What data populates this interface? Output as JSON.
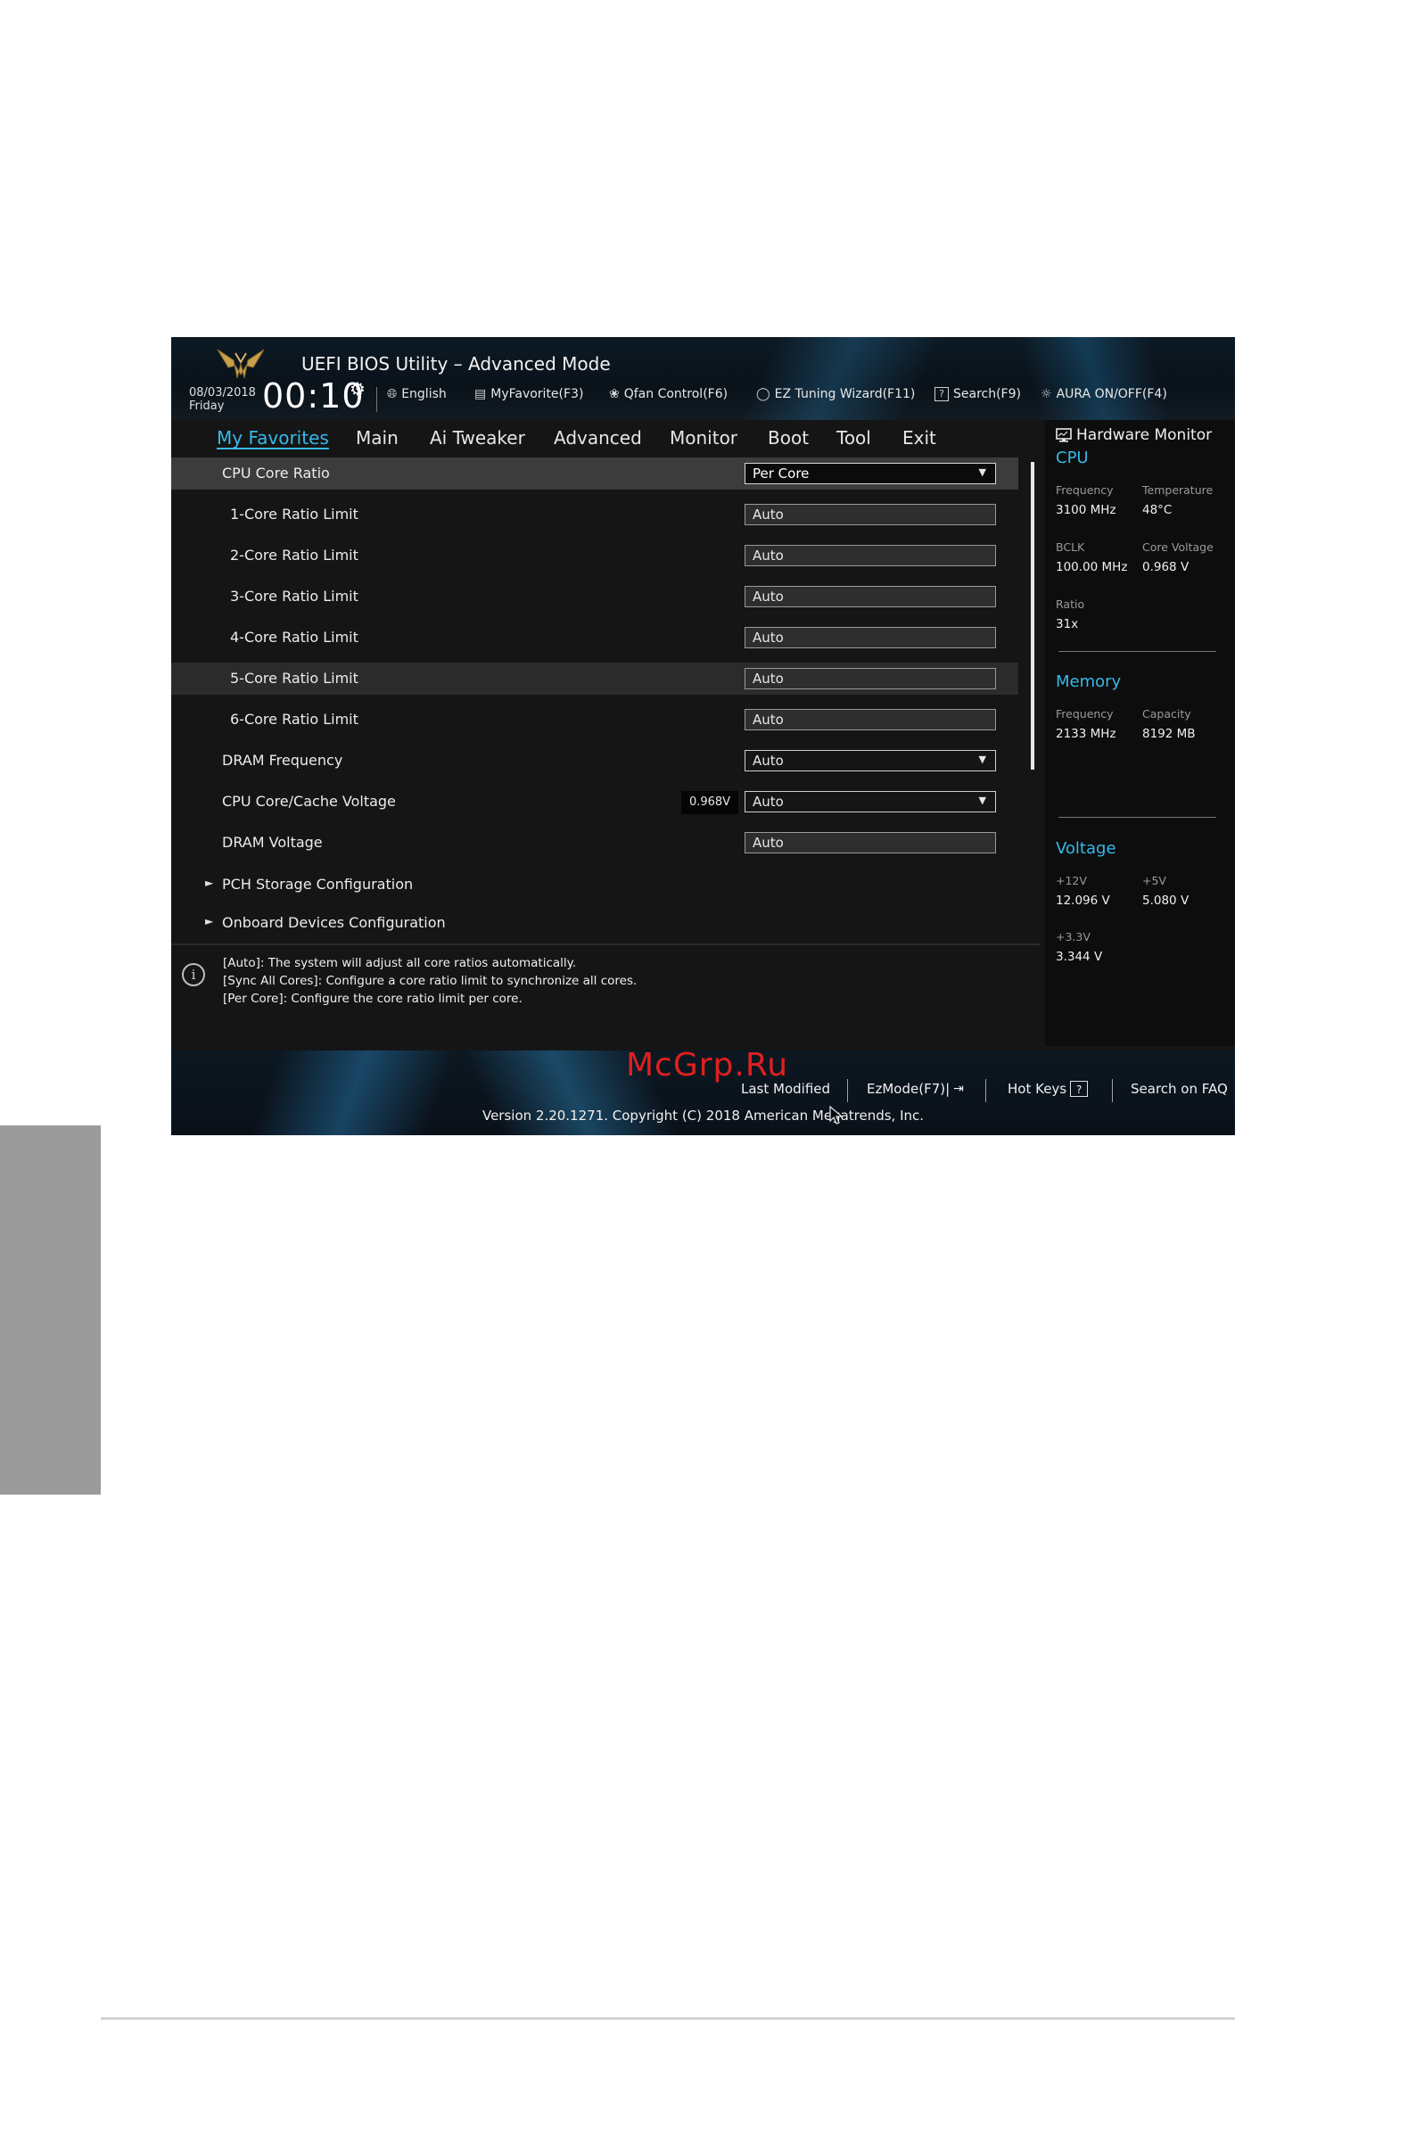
{
  "window": {
    "title": "UEFI BIOS Utility – Advanced Mode"
  },
  "header": {
    "date": "08/03/2018",
    "day": "Friday",
    "time": "00:10",
    "tools": {
      "language": "English",
      "myfavorite": "MyFavorite(F3)",
      "qfan": "Qfan Control(F6)",
      "eztuning": "EZ Tuning Wizard(F11)",
      "search": "Search(F9)",
      "aura": "AURA ON/OFF(F4)"
    }
  },
  "menu": {
    "tabs": [
      {
        "label": "My Favorites"
      },
      {
        "label": "Main"
      },
      {
        "label": "Ai Tweaker"
      },
      {
        "label": "Advanced"
      },
      {
        "label": "Monitor"
      },
      {
        "label": "Boot"
      },
      {
        "label": "Tool"
      },
      {
        "label": "Exit"
      }
    ]
  },
  "settings": {
    "rows": [
      {
        "label": "CPU Core Ratio",
        "value": "Per Core"
      },
      {
        "label": "1-Core Ratio Limit",
        "value": "Auto"
      },
      {
        "label": "2-Core Ratio Limit",
        "value": "Auto"
      },
      {
        "label": "3-Core Ratio Limit",
        "value": "Auto"
      },
      {
        "label": "4-Core Ratio Limit",
        "value": "Auto"
      },
      {
        "label": "5-Core Ratio Limit",
        "value": "Auto"
      },
      {
        "label": "6-Core Ratio Limit",
        "value": "Auto"
      },
      {
        "label": "DRAM Frequency",
        "value": "Auto"
      },
      {
        "label": "CPU Core/Cache Voltage",
        "value": "Auto",
        "readout": "0.968V"
      },
      {
        "label": "DRAM Voltage",
        "value": "Auto"
      },
      {
        "label": "PCH Storage Configuration"
      },
      {
        "label": "Onboard Devices Configuration"
      }
    ]
  },
  "help": {
    "lines": [
      "[Auto]: The system will adjust all core ratios automatically.",
      "[Sync All Cores]: Configure a core ratio limit to synchronize all cores.",
      "[Per Core]: Configure the core ratio limit per core."
    ]
  },
  "hw_monitor": {
    "title": "Hardware Monitor",
    "cpu": {
      "title": "CPU",
      "frequency_label": "Frequency",
      "frequency": "3100 MHz",
      "temperature_label": "Temperature",
      "temperature": "48°C",
      "bclk_label": "BCLK",
      "bclk": "100.00 MHz",
      "core_voltage_label": "Core Voltage",
      "core_voltage": "0.968 V",
      "ratio_label": "Ratio",
      "ratio": "31x"
    },
    "memory": {
      "title": "Memory",
      "frequency_label": "Frequency",
      "frequency": "2133 MHz",
      "capacity_label": "Capacity",
      "capacity": "8192 MB"
    },
    "voltage": {
      "title": "Voltage",
      "v12_label": "+12V",
      "v12": "12.096 V",
      "v5_label": "+5V",
      "v5": "5.080 V",
      "v33_label": "+3.3V",
      "v33": "3.344 V"
    }
  },
  "footer": {
    "last_modified": "Last Modified",
    "ezmode": "EzMode(F7)|",
    "hotkeys": "Hot Keys",
    "hotkeys_key": "?",
    "faq": "Search on FAQ",
    "version": "Version 2.20.1271. Copyright (C) 2018 American Megatrends, Inc.",
    "watermark": "McGrp.Ru"
  },
  "colors": {
    "accent": "#36b9e9",
    "panel": "#151515",
    "highlight": "#3c3c3c",
    "side_tab": "#9b9b9b"
  }
}
